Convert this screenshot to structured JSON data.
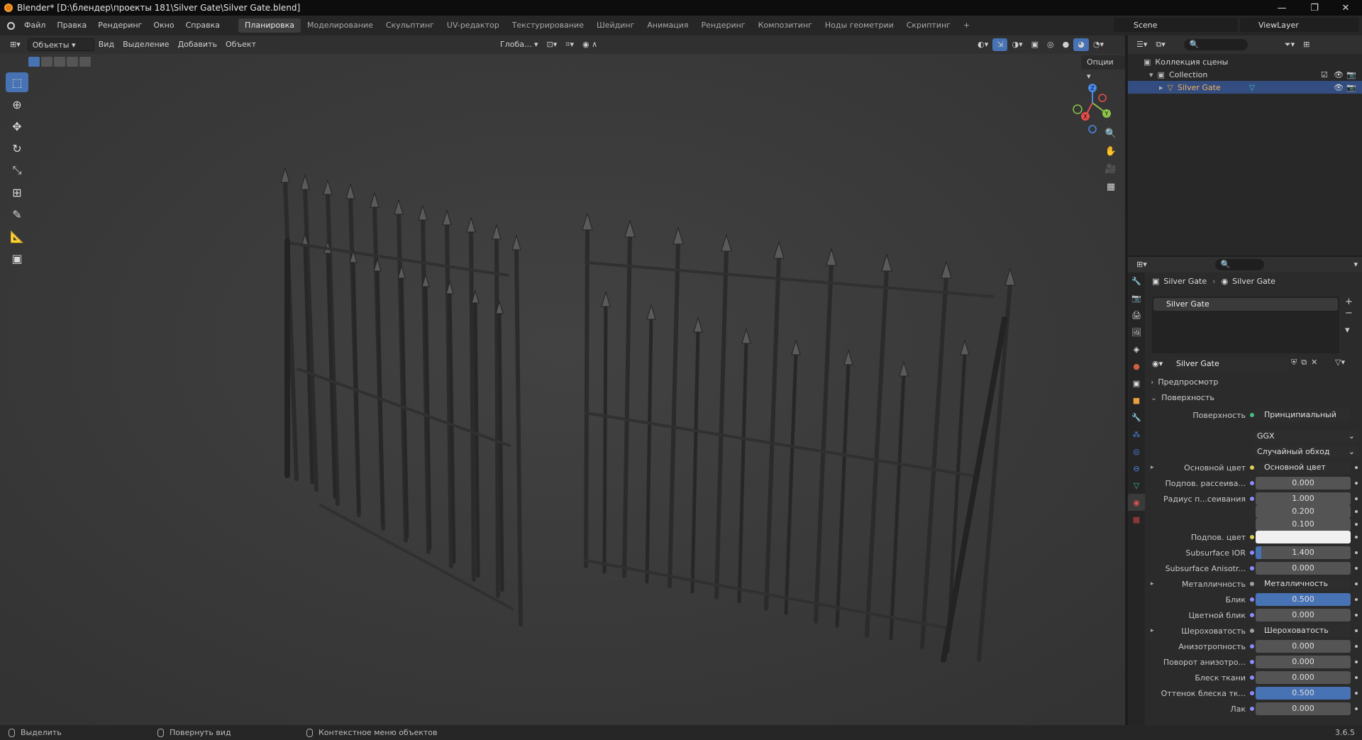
{
  "window": {
    "title": "Blender* [D:\\блендер\\проекты 181\\Silver Gate\\Silver Gate.blend]",
    "minimize": "—",
    "maximize": "❐",
    "close": "✕"
  },
  "menu": [
    "Файл",
    "Правка",
    "Рендеринг",
    "Окно",
    "Справка"
  ],
  "workspaces": [
    "Планировка",
    "Моделирование",
    "Скульптинг",
    "UV-редактор",
    "Текстурирование",
    "Шейдинг",
    "Анимация",
    "Рендеринг",
    "Композитинг",
    "Ноды геометрии",
    "Скриптинг"
  ],
  "active_workspace": "Планировка",
  "add_workspace": "+",
  "scene": "Scene",
  "view_layer": "ViewLayer",
  "viewport": {
    "mode": "Объекты",
    "menus": [
      "Вид",
      "Выделение",
      "Добавить",
      "Объект"
    ],
    "transform": "Глоба...",
    "options": "Опции"
  },
  "gizmo": {
    "x": "X",
    "y": "Y",
    "z": "Z"
  },
  "outliner": {
    "scene_collection": "Коллекция сцены",
    "collection": "Collection",
    "object": "Silver Gate"
  },
  "properties": {
    "breadcrumb_object": "Silver Gate",
    "breadcrumb_material": "Silver Gate",
    "slot": "Silver Gate",
    "material": "Silver Gate",
    "preview": "Предпросмотр",
    "surface_section": "Поверхность",
    "surface_label": "Поверхность",
    "surface_value": "Принципиальный BSDF",
    "distribution": "GGX",
    "subsurface_method": "Случайный обход",
    "rows": [
      {
        "label": "Основной цвет",
        "value": "Основной цвет",
        "kind": "link",
        "dot": "#e0d050",
        "expand": true
      },
      {
        "label": "Подпов. рассеива...",
        "value": "0.000",
        "kind": "num",
        "dot": "#8c8cff"
      },
      {
        "label": "Радиус п...сеивания",
        "value": "1.000",
        "kind": "num",
        "dot": "#8c8cff"
      },
      {
        "label": "",
        "value": "0.200",
        "kind": "num",
        "dot": ""
      },
      {
        "label": "",
        "value": "0.100",
        "kind": "num",
        "dot": ""
      },
      {
        "label": "Подпов. цвет",
        "value": "",
        "kind": "color",
        "dot": "#e0d050"
      },
      {
        "label": "Subsurface IOR",
        "value": "1.400",
        "kind": "num",
        "dot": "#8c8cff",
        "fill": 0.06
      },
      {
        "label": "Subsurface Anisotr...",
        "value": "0.000",
        "kind": "num",
        "dot": "#8c8cff"
      },
      {
        "label": "Металличность",
        "value": "Металличность",
        "kind": "link",
        "dot": "#a0a0a0",
        "expand": true
      },
      {
        "label": "Блик",
        "value": "0.500",
        "kind": "blue",
        "dot": "#8c8cff"
      },
      {
        "label": "Цветной блик",
        "value": "0.000",
        "kind": "num",
        "dot": "#8c8cff"
      },
      {
        "label": "Шероховатость",
        "value": "Шероховатость",
        "kind": "link",
        "dot": "#a0a0a0",
        "expand": true
      },
      {
        "label": "Анизотропность",
        "value": "0.000",
        "kind": "num",
        "dot": "#8c8cff"
      },
      {
        "label": "Поворот анизотро...",
        "value": "0.000",
        "kind": "num",
        "dot": "#8c8cff"
      },
      {
        "label": "Блеск ткани",
        "value": "0.000",
        "kind": "num",
        "dot": "#8c8cff"
      },
      {
        "label": "Оттенок блеска тк...",
        "value": "0.500",
        "kind": "blue",
        "dot": "#8c8cff"
      },
      {
        "label": "Лак",
        "value": "0.000",
        "kind": "num",
        "dot": "#8c8cff"
      }
    ]
  },
  "status": {
    "select": "Выделить",
    "rotate": "Повернуть вид",
    "context": "Контекстное меню объектов",
    "version": "3.6.5"
  }
}
